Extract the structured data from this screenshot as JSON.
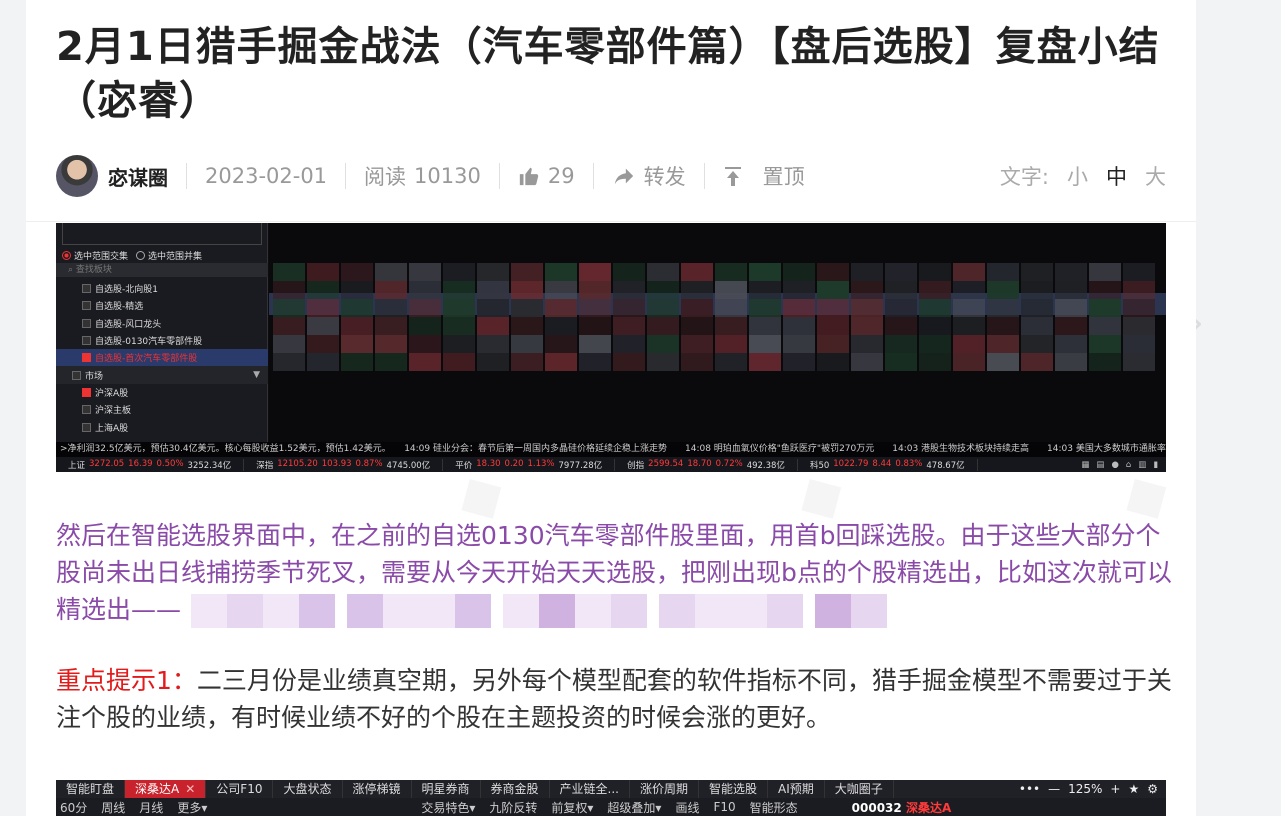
{
  "article": {
    "title": "2月1日猎手掘金战法（汽车零部件篇）【盘后选股】复盘小结（宓睿）",
    "author": "宓谋圈",
    "date": "2023-02-01",
    "read_label": "阅读",
    "read_count": "10130",
    "like_count": "29",
    "share_label": "转发",
    "pin_label": "置顶",
    "font_label": "文字:",
    "font_small": "小",
    "font_medium": "中",
    "font_large": "大"
  },
  "screenshot1": {
    "radio_intersection": "选中范围交集",
    "radio_union": "选中范围并集",
    "search_placeholder": "查找板块",
    "items": [
      "自选股-北向股1",
      "自选股-精选",
      "自选股-风口龙头",
      "自选股-0130汽车零部件股",
      "自选股-首次汽车零部件股"
    ],
    "market_label": "市场",
    "market_items": [
      "沪深A股",
      "沪深主板",
      "上海A股"
    ],
    "ticker": ">净利润32.5亿美元，预估30.4亿美元。核心每股收益1.52美元，预估1.42美元。　　14:09 硅业分会：春节后第一周国内多晶硅价格延续企稳上涨走势　　14:08 明珀血氧仪价格\"鱼跃医疗\"被罚270万元　　14:03 港股生物技术板块持续走高　　14:03 美国大多数城市通胀率超过",
    "indices": [
      {
        "name": "上证",
        "price": "3272.05",
        "chg": "16.39",
        "pct": "0.50%",
        "amt": "3252.34亿"
      },
      {
        "name": "深指",
        "price": "12105.20",
        "chg": "103.93",
        "pct": "0.87%",
        "amt": "4745.00亿"
      },
      {
        "name": "平价",
        "price": "18.30",
        "chg": "0.20",
        "pct": "1.13%",
        "amt": "7977.28亿"
      },
      {
        "name": "创指",
        "price": "2599.54",
        "chg": "18.70",
        "pct": "0.72%",
        "amt": "492.38亿"
      },
      {
        "name": "科50",
        "price": "1022.79",
        "chg": "8.44",
        "pct": "0.83%",
        "amt": "478.67亿"
      }
    ]
  },
  "paragraphs": {
    "p1": "然后在智能选股界面中，在之前的自选0130汽车零部件股里面，用首b回踩选股。由于这些大部分个股尚未出日线捕捞季节死叉，需要从今天开始天天选股，把刚出现b点的个股精选出，比如这次就可以精选出——",
    "p2_highlight": "重点提示1：",
    "p2": "二三月份是业绩真空期，另外每个模型配套的软件指标不同，猎手掘金模型不需要过于关注个股的业绩，有时候业绩不好的个股在主题投资的时候会涨的更好。"
  },
  "screenshot2": {
    "tabs": [
      "智能盯盘",
      "深桑达A",
      "公司F10",
      "大盘状态",
      "涨停梯镜",
      "明星券商",
      "券商金股",
      "产业链全...",
      "涨价周期",
      "智能选股",
      "AI预期",
      "大咖圈子"
    ],
    "active_tab": "深桑达A",
    "zoom": "125%",
    "subbar": [
      "60分",
      "周线",
      "月线",
      "更多▾",
      "交易特色▾",
      "九阶反转",
      "前复权▾",
      "超级叠加▾",
      "画线",
      "F10",
      "智能形态"
    ],
    "stock_code": "000032",
    "stock_name": "深桑达A"
  }
}
